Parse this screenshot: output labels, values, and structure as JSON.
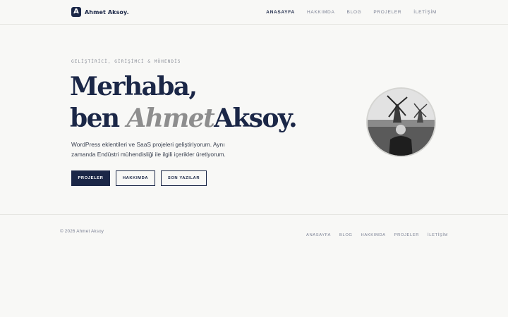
{
  "header": {
    "logo_letter": "A",
    "brand": "Ahmet Aksoy.",
    "nav": [
      "ANASAYFA",
      "HAKKIMDA",
      "BLOG",
      "PROJELER",
      "İLETİŞİM"
    ]
  },
  "hero": {
    "eyebrow": "GELİŞTİRİCİ, GİRİŞİMCİ & MÜHENDİS",
    "title_line1": "Merhaba,",
    "title_pre": "ben ",
    "title_em": "Ahmet",
    "title_post": "Aksoy.",
    "subtitle": "WordPress eklentileri ve SaaS projeleri geliştiriyorum. Aynı zamanda Endüstri mühendisliği ile ilgili içerikler üretiyorum.",
    "buttons": [
      "PROJELER",
      "HAKKIMDA",
      "SON YAZILAR"
    ]
  },
  "footer": {
    "copyright": "© 2026 Ahmet Aksoy",
    "nav": [
      "ANASAYFA",
      "BLOG",
      "HAKKIMDA",
      "PROJELER",
      "İLETİŞİM"
    ]
  },
  "colors": {
    "brand": "#1b2747",
    "accent_muted": "#8e8e8e",
    "background": "#f8f8f6"
  }
}
